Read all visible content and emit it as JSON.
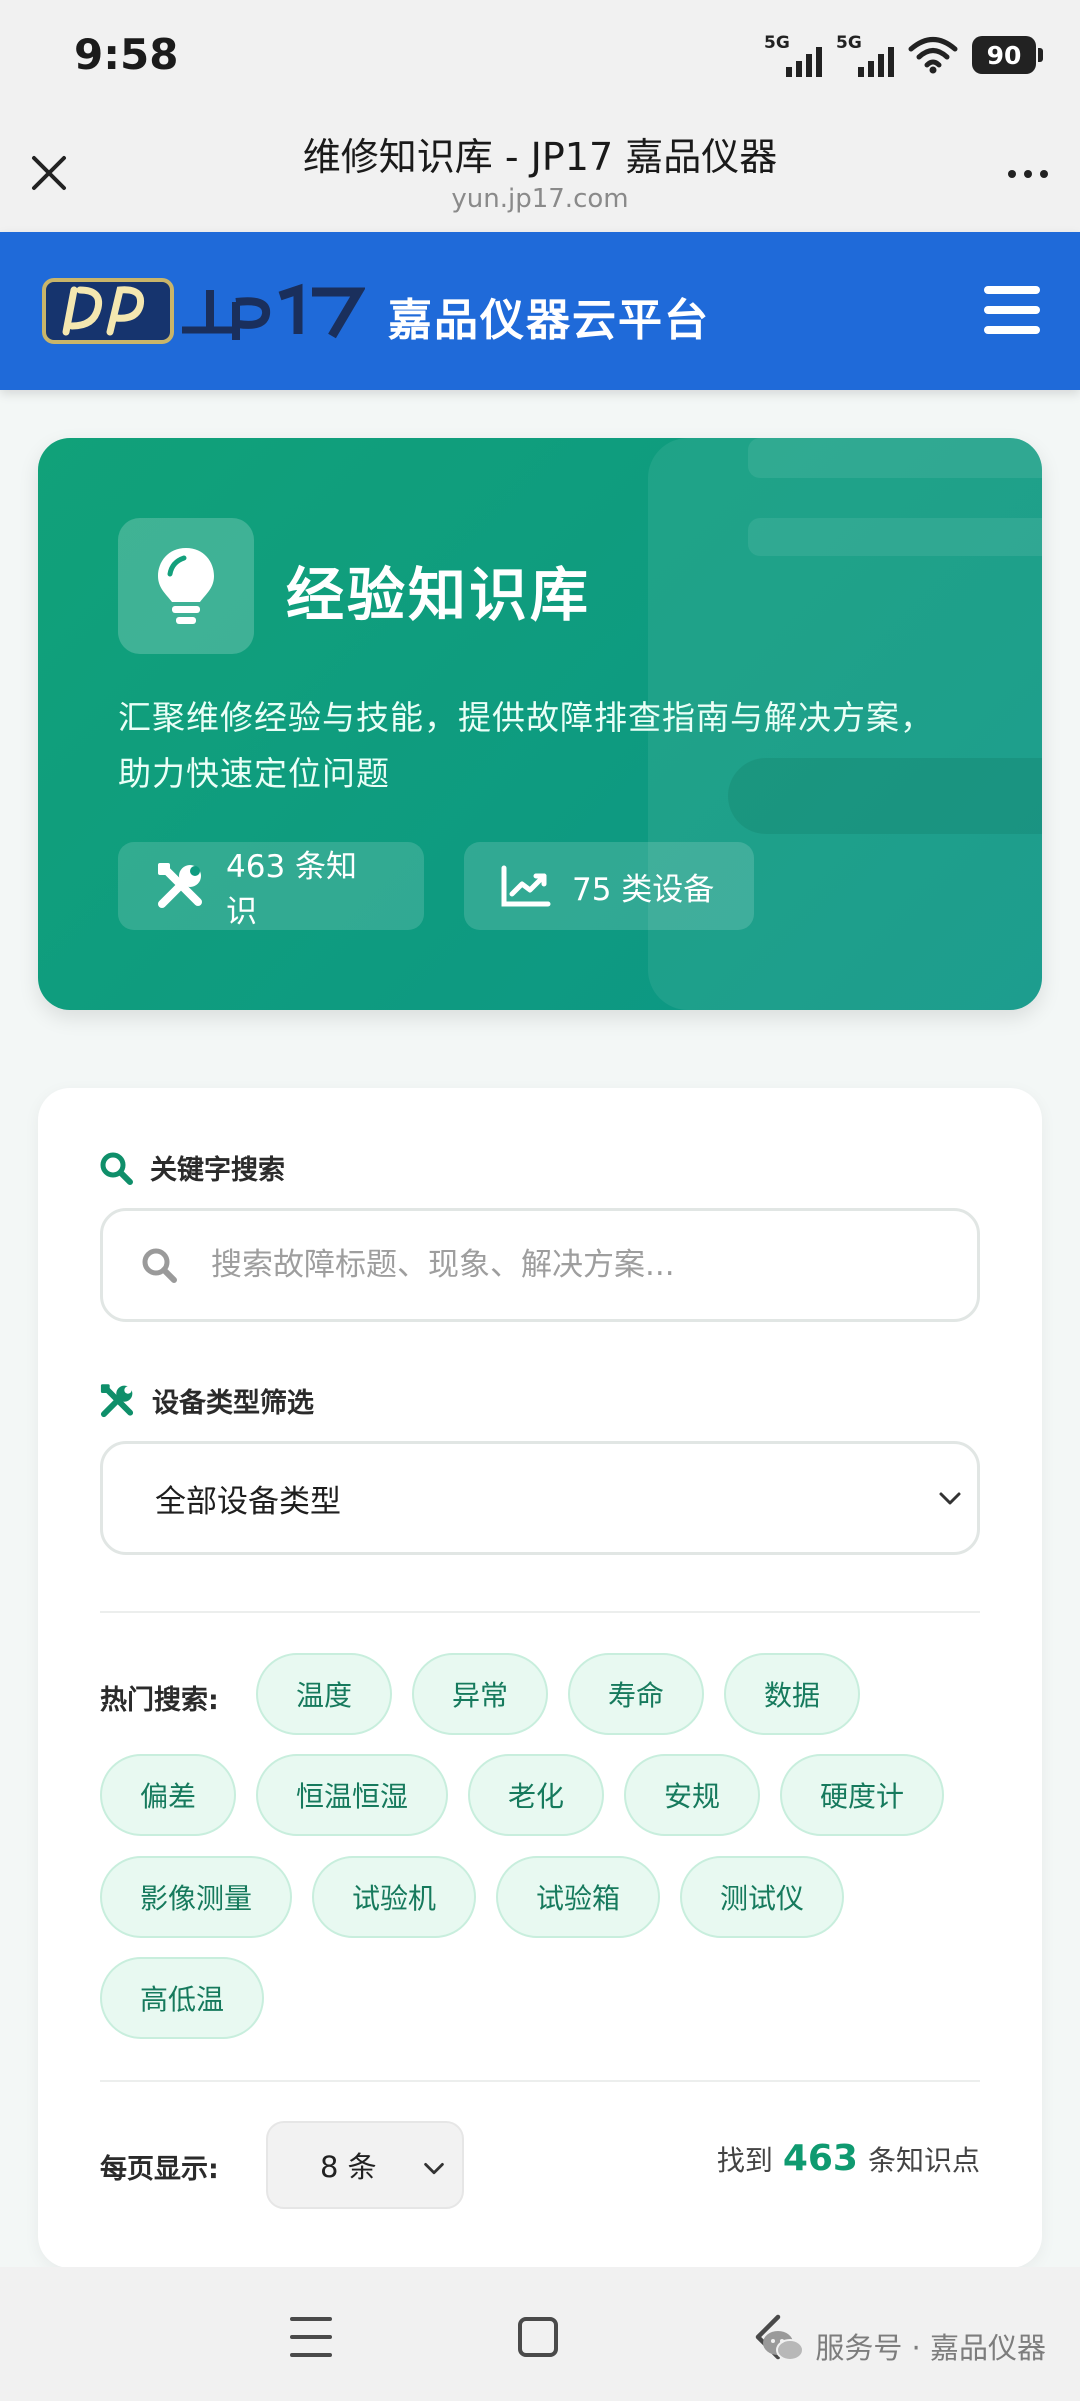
{
  "status_bar": {
    "time": "9:58",
    "network_1": "5G",
    "network_2": "5G",
    "battery": "90"
  },
  "browser": {
    "title": "维修知识库 - JP17 嘉品仪器",
    "url": "yun.jp17.com",
    "close_icon": "close-icon",
    "more_icon": "more-icon"
  },
  "site_nav": {
    "logo_text": "jp17",
    "platform_name": "嘉品仪器云平台",
    "menu_icon": "hamburger-icon"
  },
  "hero": {
    "icon": "lightbulb-icon",
    "title": "经验知识库",
    "description": "汇聚维修经验与技能，提供故障排查指南与解决方案，助力快速定位问题",
    "stats": {
      "knowledge": "463 条知识",
      "devices": "75 类设备"
    }
  },
  "filters": {
    "search_label": "关键字搜索",
    "search_placeholder": "搜索故障标题、现象、解决方案...",
    "type_label": "设备类型筛选",
    "type_selected": "全部设备类型",
    "hot_label": "热门搜索:",
    "hot_tags": [
      "温度",
      "异常",
      "寿命",
      "数据",
      "偏差",
      "恒温恒湿",
      "老化",
      "安规",
      "硬度计",
      "影像测量",
      "试验机",
      "试验箱",
      "测试仪",
      "高低温"
    ],
    "per_page_label": "每页显示:",
    "per_page_value": "8 条",
    "result_prefix": "找到",
    "result_count": "463",
    "result_suffix": "条知识点"
  },
  "colors": {
    "nav_blue": "#1f6ad9",
    "hero_green": "#11a179",
    "accent_green": "#0f9a70",
    "tag_bg": "#e8f9f1"
  },
  "watermark": "服务号 · 嘉品仪器"
}
